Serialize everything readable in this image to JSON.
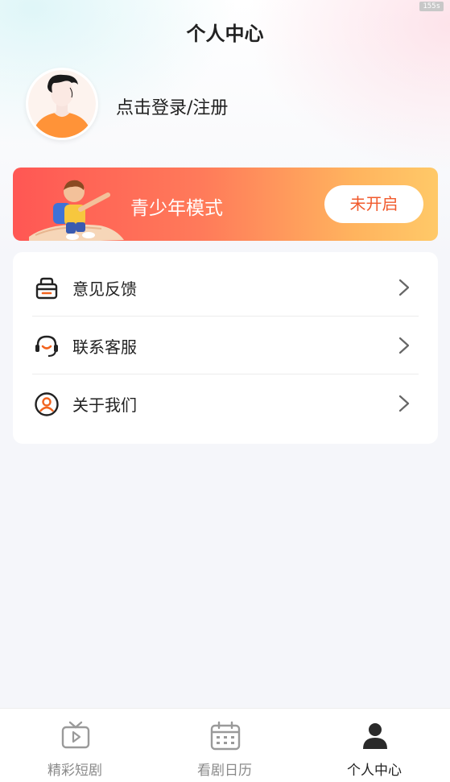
{
  "status": {
    "time": "155s"
  },
  "header": {
    "title": "个人中心"
  },
  "profile": {
    "login_text": "点击登录/注册",
    "avatar": "user-avatar-illustration"
  },
  "teen_mode": {
    "label": "青少年模式",
    "button": "未开启",
    "illustration": "boy-on-paper-plane"
  },
  "menu": {
    "items": [
      {
        "label": "意见反馈",
        "icon": "feedback-icon"
      },
      {
        "label": "联系客服",
        "icon": "headset-icon"
      },
      {
        "label": "关于我们",
        "icon": "about-user-icon"
      }
    ]
  },
  "tabs": [
    {
      "label": "精彩短剧",
      "icon": "tv-play-icon",
      "active": false
    },
    {
      "label": "看剧日历",
      "icon": "calendar-icon",
      "active": false
    },
    {
      "label": "个人中心",
      "icon": "person-icon",
      "active": true
    }
  ],
  "colors": {
    "accent": "#f15a2c",
    "icon_orange": "#f2641f",
    "banner_start": "#ff5754",
    "banner_end": "#ffc968",
    "tab_active": "#222222",
    "tab_inactive": "#8a8a8a"
  }
}
